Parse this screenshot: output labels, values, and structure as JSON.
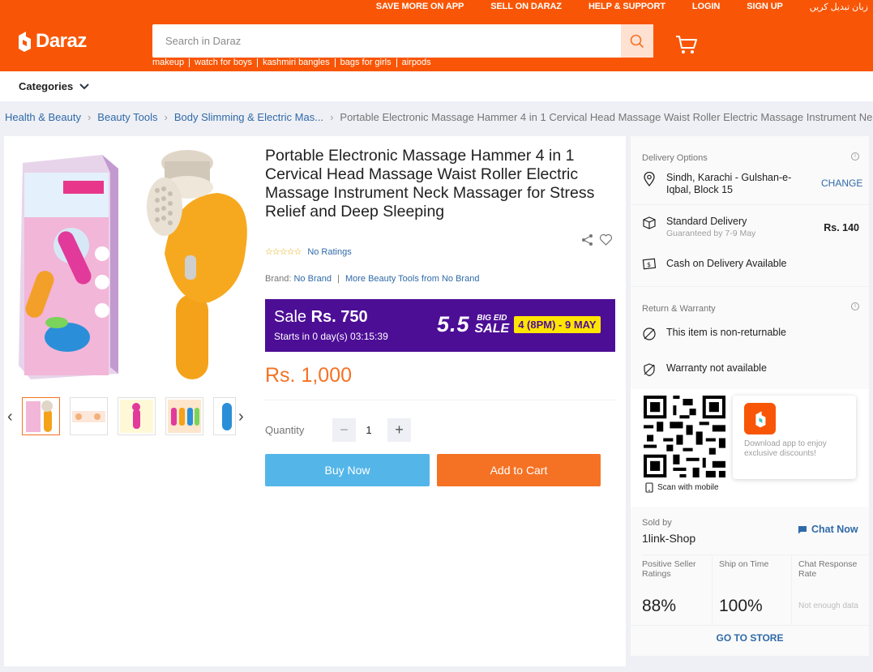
{
  "top_links": [
    "SAVE MORE ON APP",
    "SELL ON DARAZ",
    "HELP & SUPPORT",
    "LOGIN",
    "SIGN UP",
    "زبان تبدیل کریں"
  ],
  "logo_text": "Daraz",
  "search": {
    "placeholder": "Search in Daraz"
  },
  "suggestions": [
    "makeup",
    "watch for boys",
    "kashmiri bangles",
    "bags for girls",
    "airpods"
  ],
  "categories_label": "Categories",
  "breadcrumbs": [
    "Health & Beauty",
    "Beauty Tools",
    "Body Slimming & Electric Mas..."
  ],
  "breadcrumb_current": "Portable Electronic Massage Hammer 4 in 1 Cervical Head Massage Waist Roller Electric Massage Instrument Neck",
  "product": {
    "title": "Portable Electronic Massage Hammer 4 in 1 Cervical Head Massage Waist Roller Electric Massage Instrument Neck Massager for Stress Relief and Deep Sleeping",
    "ratings_text": "No Ratings",
    "stars": "☆☆☆☆☆",
    "brand_label": "Brand:",
    "brand_value": "No Brand",
    "brand_more": "More Beauty Tools from No Brand",
    "price": "Rs. 1,000",
    "quantity_label": "Quantity",
    "quantity": "1",
    "buy_now": "Buy Now",
    "add_to_cart": "Add to Cart"
  },
  "sale": {
    "label": "Sale",
    "price": "Rs. 750",
    "starts": "Starts in 0 day(s) 03:15:39",
    "event_number": "5.5",
    "event_line1": "BIG EID",
    "event_line2": "SALE",
    "event_dates": "4 (8PM) - 9 MAY"
  },
  "delivery": {
    "header": "Delivery Options",
    "location": "Sindh, Karachi - Gulshan-e-Iqbal, Block 15",
    "change": "CHANGE",
    "standard": "Standard Delivery",
    "guarantee": "Guaranteed by 7-9 May",
    "fee": "Rs. 140",
    "cod": "Cash on Delivery Available"
  },
  "warranty": {
    "header": "Return & Warranty",
    "return": "This item is non-returnable",
    "warranty": "Warranty not available"
  },
  "app": {
    "scan": "Scan with mobile",
    "promo": "Download app to enjoy exclusive discounts!"
  },
  "seller": {
    "sold_by": "Sold by",
    "name": "1link-Shop",
    "chat": "Chat Now",
    "metrics": [
      {
        "label": "Positive Seller Ratings",
        "value": "88%"
      },
      {
        "label": "Ship on Time",
        "value": "100%"
      },
      {
        "label": "Chat Response Rate",
        "value": "Not enough data"
      }
    ],
    "goto": "GO TO STORE"
  },
  "colors": {
    "brand": "#f85606",
    "accent": "#f57224",
    "link": "#2f6aa8",
    "buy": "#54b6e8",
    "sale_bg": "#4d0e96"
  }
}
